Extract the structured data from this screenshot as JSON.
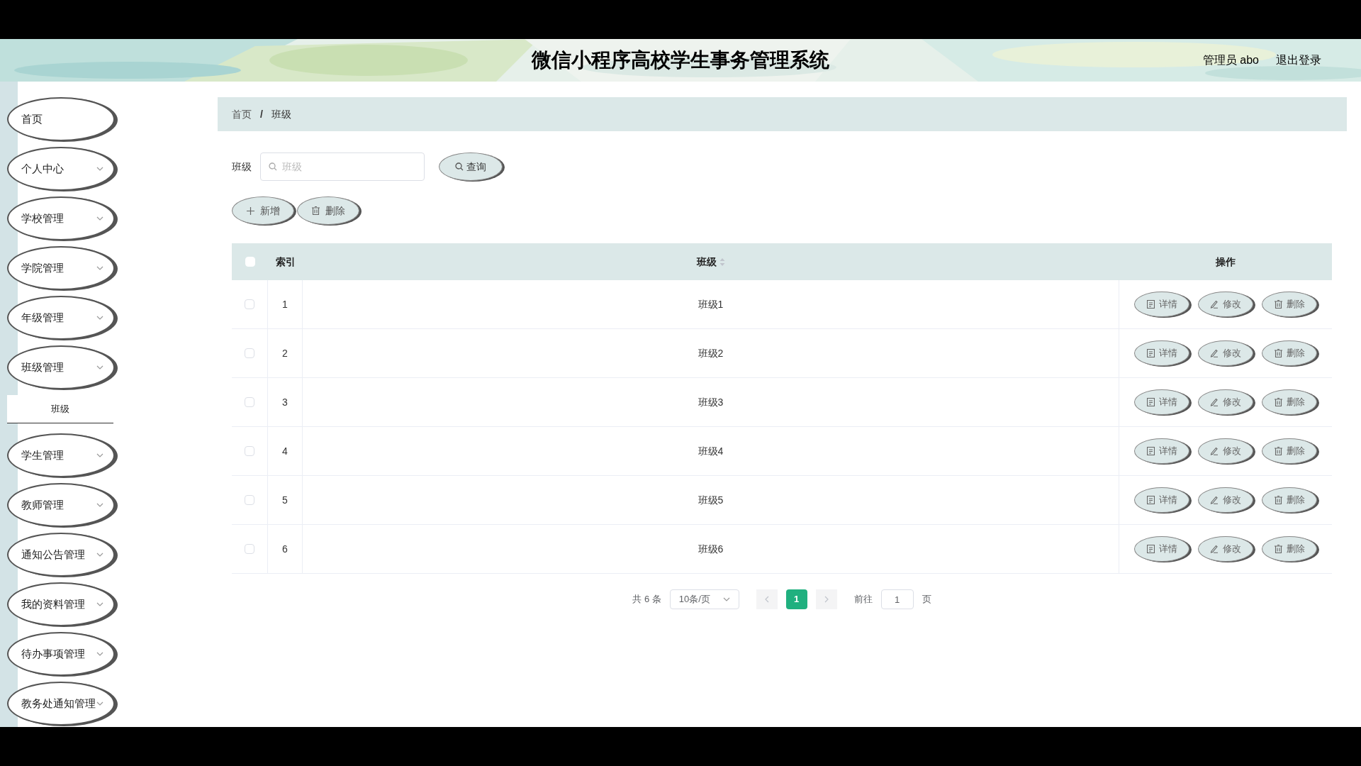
{
  "header": {
    "title": "微信小程序高校学生事务管理系统",
    "user": "管理员 abo",
    "logout": "退出登录"
  },
  "sidebar": {
    "items": [
      {
        "label": "首页",
        "kind": "link"
      },
      {
        "label": "个人中心",
        "kind": "menu"
      },
      {
        "label": "学校管理",
        "kind": "menu"
      },
      {
        "label": "学院管理",
        "kind": "menu"
      },
      {
        "label": "年级管理",
        "kind": "menu"
      },
      {
        "label": "班级管理",
        "kind": "menu",
        "children": [
          {
            "label": "班级",
            "selected": true
          }
        ]
      },
      {
        "label": "学生管理",
        "kind": "menu"
      },
      {
        "label": "教师管理",
        "kind": "menu"
      },
      {
        "label": "通知公告管理",
        "kind": "menu"
      },
      {
        "label": "我的资料管理",
        "kind": "menu"
      },
      {
        "label": "待办事项管理",
        "kind": "menu"
      },
      {
        "label": "教务处通知管理",
        "kind": "menu"
      }
    ]
  },
  "breadcrumb": {
    "items": [
      "首页",
      "班级"
    ],
    "separator": "/"
  },
  "search": {
    "label": "班级",
    "placeholder": "班级",
    "button": "查询"
  },
  "actions": [
    {
      "label": "新增",
      "kind": "add"
    },
    {
      "label": "删除",
      "kind": "delete"
    }
  ],
  "table": {
    "select_all": false,
    "columns": [
      {
        "label": "索引"
      },
      {
        "label": "班级",
        "sortable": true
      },
      {
        "label": "操作"
      }
    ],
    "rows": [
      {
        "checked": false,
        "index": "1",
        "name": "班级1",
        "actions": [
          {
            "label": "详情",
            "kind": "detail"
          },
          {
            "label": "修改",
            "kind": "edit"
          },
          {
            "label": "删除",
            "kind": "delete"
          }
        ]
      },
      {
        "checked": false,
        "index": "2",
        "name": "班级2",
        "actions": [
          {
            "label": "详情",
            "kind": "detail"
          },
          {
            "label": "修改",
            "kind": "edit"
          },
          {
            "label": "删除",
            "kind": "delete"
          }
        ]
      },
      {
        "checked": false,
        "index": "3",
        "name": "班级3",
        "actions": [
          {
            "label": "详情",
            "kind": "detail"
          },
          {
            "label": "修改",
            "kind": "edit"
          },
          {
            "label": "删除",
            "kind": "delete"
          }
        ]
      },
      {
        "checked": false,
        "index": "4",
        "name": "班级4",
        "actions": [
          {
            "label": "详情",
            "kind": "detail"
          },
          {
            "label": "修改",
            "kind": "edit"
          },
          {
            "label": "删除",
            "kind": "delete"
          }
        ]
      },
      {
        "checked": false,
        "index": "5",
        "name": "班级5",
        "actions": [
          {
            "label": "详情",
            "kind": "detail"
          },
          {
            "label": "修改",
            "kind": "edit"
          },
          {
            "label": "删除",
            "kind": "delete"
          }
        ]
      },
      {
        "checked": false,
        "index": "6",
        "name": "班级6",
        "actions": [
          {
            "label": "详情",
            "kind": "detail"
          },
          {
            "label": "修改",
            "kind": "edit"
          },
          {
            "label": "删除",
            "kind": "delete"
          }
        ]
      }
    ]
  },
  "pagination": {
    "total": "共 6 条",
    "page_size": "10条/页",
    "pages": [
      {
        "label": "1",
        "selected": true
      }
    ],
    "goto_label": "前往",
    "goto_value": "1",
    "goto_suffix": "页"
  }
}
